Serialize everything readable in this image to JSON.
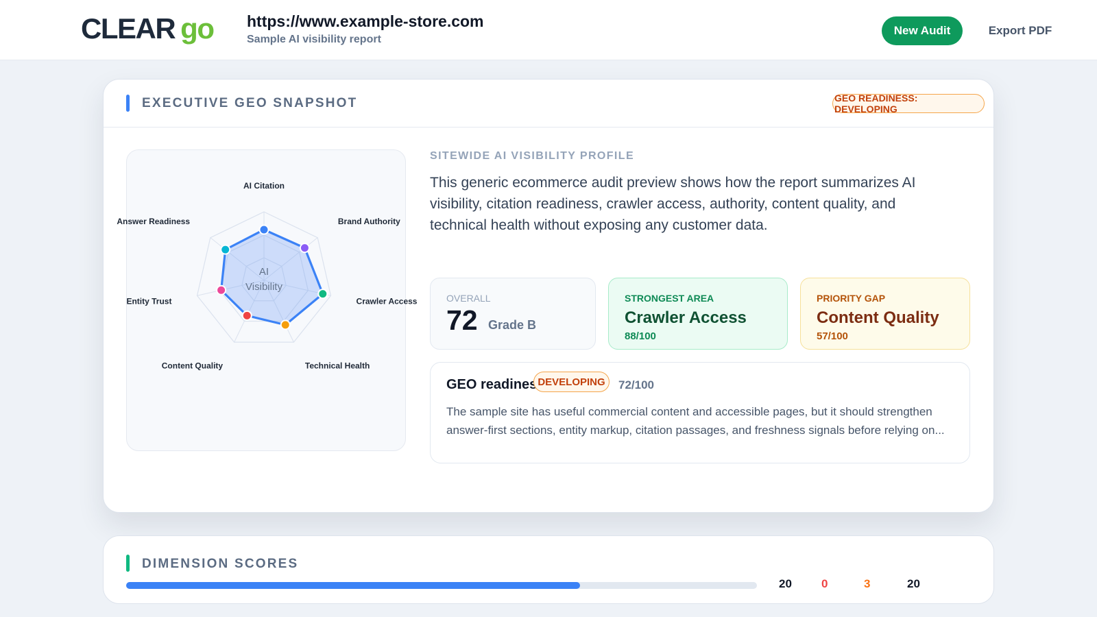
{
  "brand": {
    "logo_main": "CLEAR",
    "logo_accent": "go",
    "accent_color": "#6cbf3a"
  },
  "header": {
    "url": "https://www.example-store.com",
    "subtitle": "Sample AI visibility report",
    "new_audit_label": "New Audit",
    "export_label": "Export PDF"
  },
  "snapshot": {
    "title": "EXECUTIVE GEO SNAPSHOT",
    "readiness_pill": "GEO READINESS: DEVELOPING",
    "profile_label": "SITEWIDE AI VISIBILITY PROFILE",
    "profile_description": "This generic ecommerce audit preview shows how the report summarizes AI visibility, citation readiness, crawler access, authority, content quality, and technical health without exposing any customer data.",
    "radar": {
      "center_line1": "AI",
      "center_line2": "Visibility",
      "dimensions": [
        {
          "label": "AI Citation",
          "value": 74,
          "color": "#3b82f6"
        },
        {
          "label": "Brand Authority",
          "value": 76,
          "color": "#8b5cf6"
        },
        {
          "label": "Crawler Access",
          "value": 88,
          "color": "#10b981"
        },
        {
          "label": "Technical Health",
          "value": 72,
          "color": "#f59e0b"
        },
        {
          "label": "Content Quality",
          "value": 57,
          "color": "#ef4444"
        },
        {
          "label": "Entity Trust",
          "value": 64,
          "color": "#ec4899"
        },
        {
          "label": "Answer Readiness",
          "value": 72,
          "color": "#06b6d4"
        }
      ]
    },
    "overall": {
      "label": "OVERALL",
      "score": "72",
      "grade": "Grade B"
    },
    "strongest": {
      "label": "STRONGEST AREA",
      "area": "Crawler Access",
      "score": "88/100"
    },
    "priority_gap": {
      "label": "PRIORITY GAP",
      "area": "Content Quality",
      "score": "57/100"
    },
    "readiness": {
      "title": "GEO readiness",
      "badge": "DEVELOPING",
      "score": "72/100",
      "body": "The sample site has useful commercial content and accessible pages, but it should strengthen answer-first sections, entity markup, citation passages, and freshness signals before relying on..."
    }
  },
  "dimension_scores": {
    "title": "DIMENSION SCORES",
    "progress_fraction": 0.72,
    "counts": [
      {
        "value": "20",
        "color": "#111827"
      },
      {
        "value": "0",
        "color": "#ef4444"
      },
      {
        "value": "3",
        "color": "#f97316"
      },
      {
        "value": "20",
        "color": "#111827"
      }
    ]
  }
}
